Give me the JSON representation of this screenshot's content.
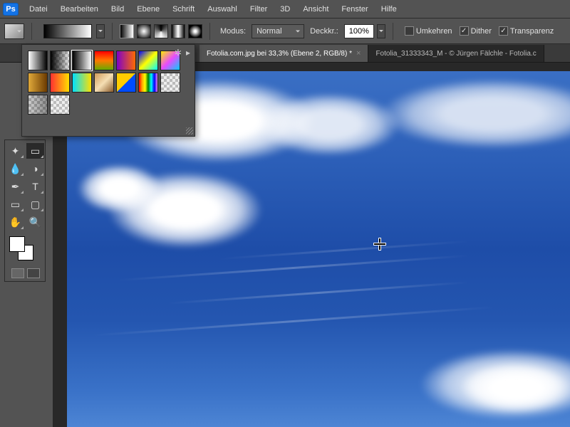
{
  "app": {
    "logo_text": "Ps"
  },
  "menu": [
    "Datei",
    "Bearbeiten",
    "Bild",
    "Ebene",
    "Schrift",
    "Auswahl",
    "Filter",
    "3D",
    "Ansicht",
    "Fenster",
    "Hilfe"
  ],
  "options": {
    "mode_label": "Modus:",
    "mode_value": "Normal",
    "opacity_label": "Deckkr.:",
    "opacity_value": "100%",
    "reverse_label": "Umkehren",
    "reverse_checked": false,
    "dither_label": "Dither",
    "dither_checked": true,
    "transparency_label": "Transparenz",
    "transparency_checked": true
  },
  "tabs": [
    {
      "title": "Fotolia.com.jpg bei 33,3% (Ebene 2, RGB/8) *",
      "active": true
    },
    {
      "title": "Fotolia_31333343_M - © Jürgen Fälchle - Fotolia.c",
      "active": false
    }
  ],
  "gradient_presets": [
    "foreground-to-background",
    "foreground-to-transparent",
    "black-white",
    "red-green",
    "violet-orange",
    "blue-yellow-cyan",
    "yellow-magenta-cyan",
    "copper",
    "red-yellow",
    "cyan-yellow",
    "chrome",
    "blue-yellow-hard",
    "spectrum",
    "transparent-1",
    "neutral-density",
    "transparent-2"
  ],
  "tools_left": [
    "history-brush",
    "gradient",
    "dodge",
    "mixer-brush",
    "blur",
    "sponge",
    "pen",
    "type",
    "path-select",
    "rectangle",
    "hand",
    "zoom"
  ],
  "colors": {
    "foreground": "#ffffff",
    "background": "#ffffff"
  }
}
